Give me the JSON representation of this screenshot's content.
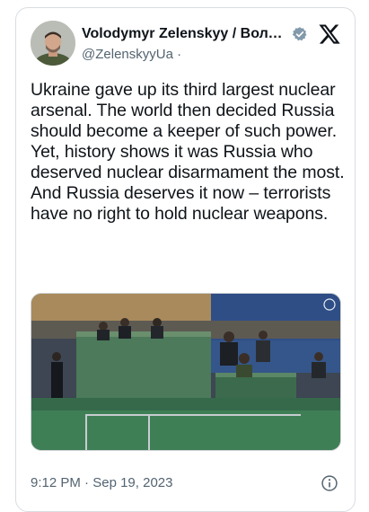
{
  "author": {
    "display_name": "Volodymyr Zelenskyy / Воло…",
    "handle": "@ZelenskyyUa",
    "separator": "·",
    "verified": true
  },
  "platform": {
    "logo_icon": "x-logo-icon"
  },
  "tweet": {
    "text": "Ukraine gave up its third largest nuclear arsenal. The world then decided Russia should become a keeper of such power. Yet, history shows it was Russia who deserved nuclear disarmament the most. And Russia deserves it now – terrorists have no right to hold nuclear weapons."
  },
  "media": {
    "type": "video-still",
    "icon": "un-emblem-icon"
  },
  "meta": {
    "time": "9:12 PM",
    "dot": "·",
    "date": "Sep 19, 2023",
    "info_icon": "info-icon"
  },
  "colors": {
    "text": "#0f1419",
    "secondary": "#536471",
    "verified_badge": "#829aab",
    "hall_green": "#3f7f55"
  }
}
